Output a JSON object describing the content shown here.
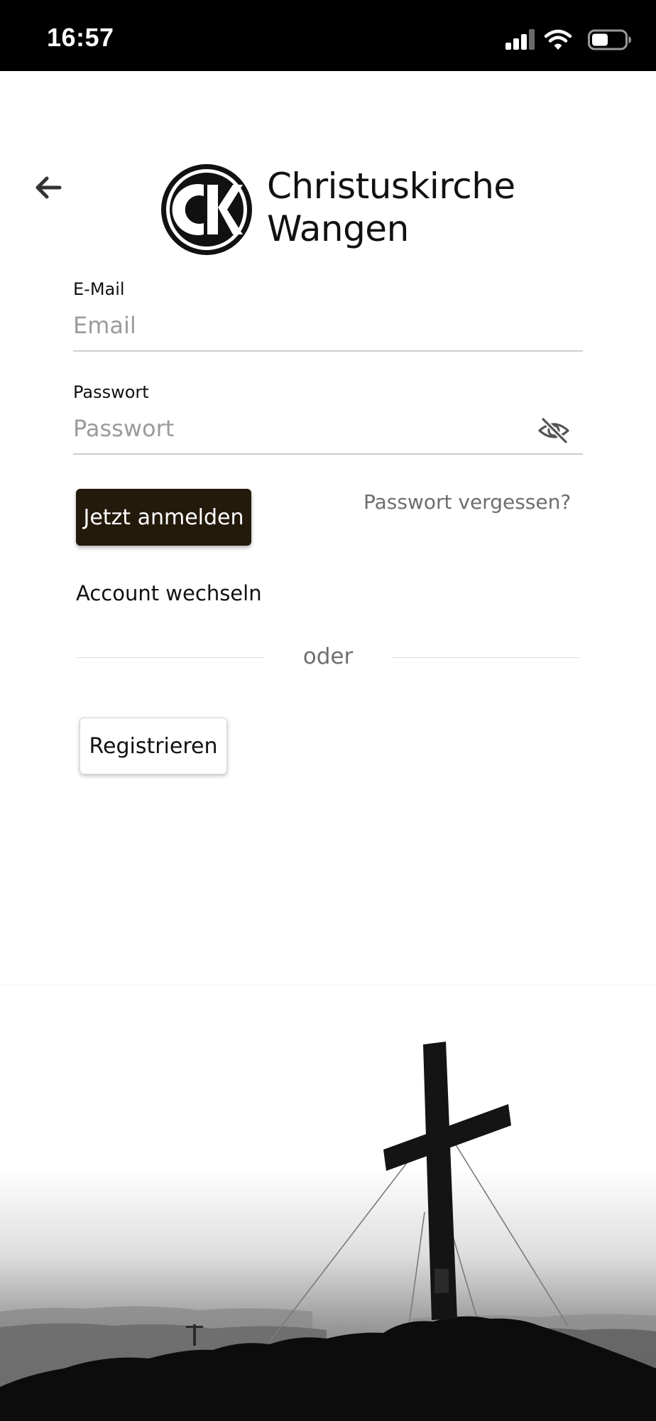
{
  "status_bar": {
    "time": "16:57",
    "icons": [
      "cellular-signal-icon",
      "wifi-icon",
      "battery-icon"
    ],
    "background": "#000000"
  },
  "header": {
    "back_icon": "back-arrow-icon",
    "logo": {
      "monogram": "CK",
      "name_line1": "Christuskirche",
      "name_line2": "Wangen"
    }
  },
  "form": {
    "email": {
      "label": "E-Mail",
      "placeholder": "Email",
      "value": ""
    },
    "password": {
      "label": "Passwort",
      "placeholder": "Passwort",
      "value": "",
      "toggle_icon": "eye-off-icon"
    },
    "login_label": "Jetzt anmelden",
    "forgot_label": "Passwort vergessen?",
    "switch_account_label": "Account wechseln",
    "divider_label": "oder",
    "register_label": "Registrieren"
  },
  "hero": {
    "subject": "summit-cross-silhouette"
  },
  "colors": {
    "primary_button": "#231a0c",
    "link_gray": "#6e6e6e",
    "placeholder_gray": "#9b9b9b"
  }
}
